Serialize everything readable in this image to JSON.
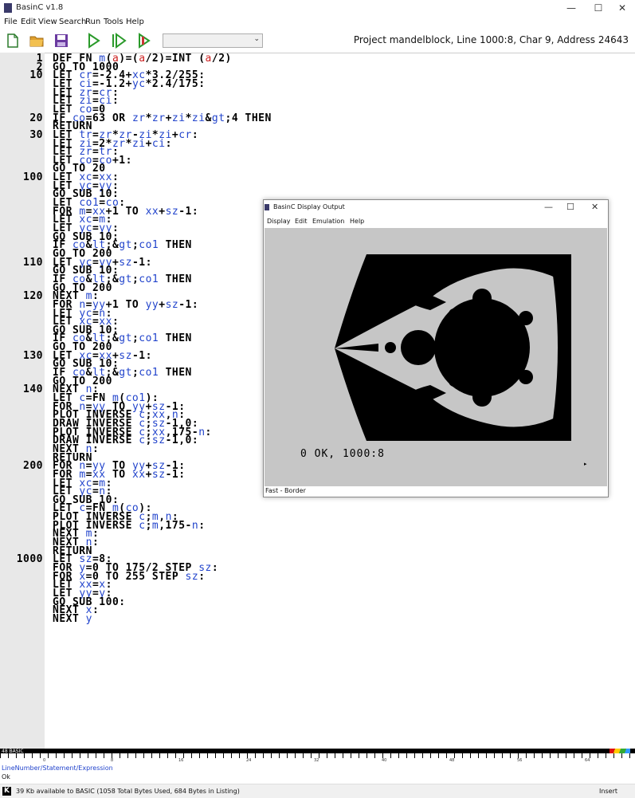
{
  "window": {
    "title": "BasinC v1.8",
    "minimize": "—",
    "maximize": "☐",
    "close": "✕"
  },
  "menu": [
    "File",
    "Edit",
    "View",
    "Search",
    "Run",
    "Tools",
    "Help"
  ],
  "toolbar": {
    "icons": [
      "new-file-icon",
      "open-folder-icon",
      "save-icon",
      "run-icon",
      "step-icon",
      "debug-icon"
    ],
    "combo_value": "",
    "project_info": "Project mandelblock, Line 1000:8, Char 9, Address 24643"
  },
  "listing": [
    {
      "num": "1",
      "text": "DEF FN m(a)=(a/2)=INT (a/2)"
    },
    {
      "num": "2",
      "text": "GO TO 1000"
    },
    {
      "num": "10",
      "text": "LET cr=-2.4+xc*3.2/255:"
    },
    {
      "num": "",
      "text": "LET ci=-1.2+yc*2.4/175:"
    },
    {
      "num": "",
      "text": "LET zr=cr:"
    },
    {
      "num": "",
      "text": "LET zi=ci:"
    },
    {
      "num": "",
      "text": "LET co=0"
    },
    {
      "num": "20",
      "text": "IF co=63 OR zr*zr+zi*zi>4 THEN"
    },
    {
      "num": "",
      "text": "RETURN"
    },
    {
      "num": "30",
      "text": "LET tr=zr*zr-zi*zi+cr:"
    },
    {
      "num": "",
      "text": "LET zi=2*zr*zi+ci:"
    },
    {
      "num": "",
      "text": "LET zr=tr:"
    },
    {
      "num": "",
      "text": "LET co=co+1:"
    },
    {
      "num": "",
      "text": "GO TO 20"
    },
    {
      "num": "100",
      "text": "LET xc=xx:"
    },
    {
      "num": "",
      "text": "LET yc=yy:"
    },
    {
      "num": "",
      "text": "GO SUB 10:"
    },
    {
      "num": "",
      "text": "LET co1=co:"
    },
    {
      "num": "",
      "text": "FOR m=xx+1 TO xx+sz-1:"
    },
    {
      "num": "",
      "text": "LET xc=m:"
    },
    {
      "num": "",
      "text": "LET yc=yy:"
    },
    {
      "num": "",
      "text": "GO SUB 10:"
    },
    {
      "num": "",
      "text": "IF co<>co1 THEN"
    },
    {
      "num": "",
      "text": "GO TO 200"
    },
    {
      "num": "110",
      "text": "LET yc=yy+sz-1:"
    },
    {
      "num": "",
      "text": "GO SUB 10:"
    },
    {
      "num": "",
      "text": "IF co<>co1 THEN"
    },
    {
      "num": "",
      "text": "GO TO 200"
    },
    {
      "num": "120",
      "text": "NEXT m:"
    },
    {
      "num": "",
      "text": "FOR n=yy+1 TO yy+sz-1:"
    },
    {
      "num": "",
      "text": "LET yc=n:"
    },
    {
      "num": "",
      "text": "LET xc=xx:"
    },
    {
      "num": "",
      "text": "GO SUB 10:"
    },
    {
      "num": "",
      "text": "IF co<>co1 THEN"
    },
    {
      "num": "",
      "text": "GO TO 200"
    },
    {
      "num": "130",
      "text": "LET xc=xx+sz-1:"
    },
    {
      "num": "",
      "text": "GO SUB 10:"
    },
    {
      "num": "",
      "text": "IF co<>co1 THEN"
    },
    {
      "num": "",
      "text": "GO TO 200"
    },
    {
      "num": "140",
      "text": "NEXT n:"
    },
    {
      "num": "",
      "text": "LET c=FN m(co1):"
    },
    {
      "num": "",
      "text": "FOR n=yy TO yy+sz-1:"
    },
    {
      "num": "",
      "text": "PLOT INVERSE c;xx,n:"
    },
    {
      "num": "",
      "text": "DRAW INVERSE c;sz-1,0:"
    },
    {
      "num": "",
      "text": "PLOT INVERSE c;xx,175-n:"
    },
    {
      "num": "",
      "text": "DRAW INVERSE c;sz-1,0:"
    },
    {
      "num": "",
      "text": "NEXT n:"
    },
    {
      "num": "",
      "text": "RETURN"
    },
    {
      "num": "200",
      "text": "FOR n=yy TO yy+sz-1:"
    },
    {
      "num": "",
      "text": "FOR m=xx TO xx+sz-1:"
    },
    {
      "num": "",
      "text": "LET xc=m:"
    },
    {
      "num": "",
      "text": "LET yc=n:"
    },
    {
      "num": "",
      "text": "GO SUB 10:"
    },
    {
      "num": "",
      "text": "LET c=FN m(co):"
    },
    {
      "num": "",
      "text": "PLOT INVERSE c;m,n:"
    },
    {
      "num": "",
      "text": "PLOT INVERSE c;m,175-n:"
    },
    {
      "num": "",
      "text": "NEXT m:"
    },
    {
      "num": "",
      "text": "NEXT n:"
    },
    {
      "num": "",
      "text": "RETURN"
    },
    {
      "num": "1000",
      "text": "LET sz=8:"
    },
    {
      "num": "",
      "text": "FOR y=0 TO 175/2 STEP sz:"
    },
    {
      "num": "",
      "text": "FOR x=0 TO 255 STEP sz:"
    },
    {
      "num": "",
      "text": "LET xx=x:"
    },
    {
      "num": "",
      "text": "LET yy=y:"
    },
    {
      "num": "",
      "text": "GO SUB 100:"
    },
    {
      "num": "",
      "text": "NEXT x:"
    },
    {
      "num": "",
      "text": "NEXT y"
    }
  ],
  "ruler": {
    "mode": "48 BASIC",
    "ticks": [
      "0",
      "8",
      "16",
      "24",
      "32",
      "40",
      "48",
      "56",
      "64"
    ]
  },
  "hint": "LineNumber/Statement/Expression",
  "ok": "Ok",
  "status": {
    "k": "K",
    "memory": "39 Kb available to BASIC (1058 Total Bytes Used, 684 Bytes in Listing)",
    "mode": "Insert"
  },
  "display": {
    "title": "BasinC Display Output",
    "menu": [
      "Display",
      "Edit",
      "Emulation",
      "Help"
    ],
    "screen_text": "0 OK, 1000:8",
    "cursor": "▸",
    "status": "Fast - Border"
  }
}
